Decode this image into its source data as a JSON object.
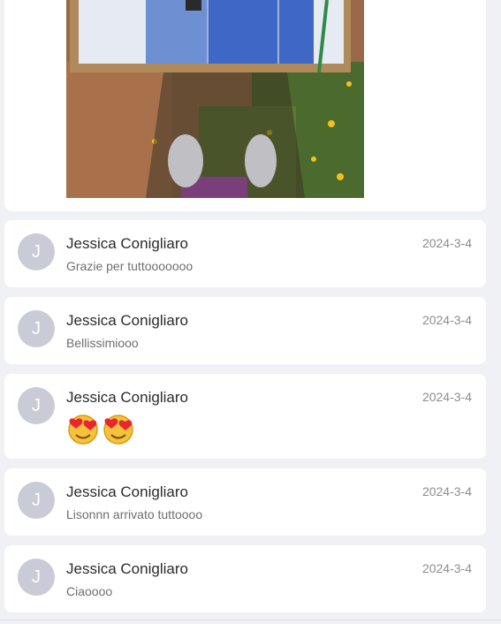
{
  "photo": {
    "alt": "feet-on-flowers-photo"
  },
  "comments": [
    {
      "avatar": "J",
      "name": "Jessica Conigliaro",
      "date": "2024-3-4",
      "text": "Grazie per tuttooooooo"
    },
    {
      "avatar": "J",
      "name": "Jessica Conigliaro",
      "date": "2024-3-4",
      "text": "Bellissimiooo"
    },
    {
      "avatar": "J",
      "name": "Jessica Conigliaro",
      "date": "2024-3-4",
      "emojis": [
        "heart-eyes-emoji",
        "heart-eyes-emoji"
      ]
    },
    {
      "avatar": "J",
      "name": "Jessica Conigliaro",
      "date": "2024-3-4",
      "text": "Lisonnn arrivato tuttoooo"
    },
    {
      "avatar": "J",
      "name": "Jessica Conigliaro",
      "date": "2024-3-4",
      "text": "Ciaoooo"
    }
  ]
}
